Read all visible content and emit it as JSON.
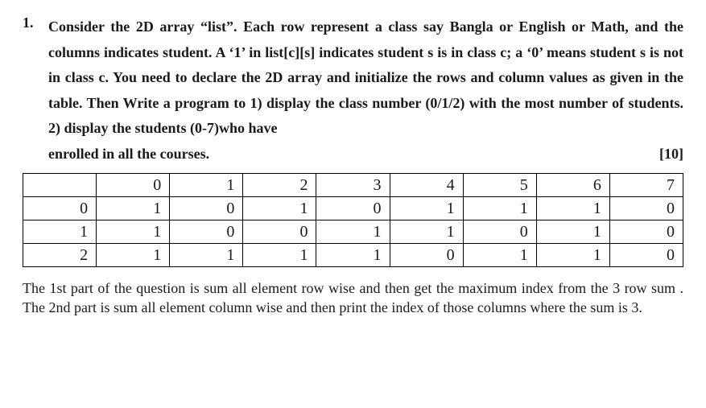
{
  "question": {
    "number": "1.",
    "prompt_line1": "Consider the 2D array “list”. Each row represent a class say Bangla or  English or Math,",
    "prompt_line2": "and the columns indicates student. A ‘1’ in list[c][s] indicates student s is in class c; a ‘0’",
    "prompt_line3": "means student s is not in class c.  You need to declare the 2D array and initialize the rows",
    "prompt_line4": "and column values as given in the table. Then Write a program to 1) display the class",
    "prompt_line5": "number (0/1/2) with the most number of students. 2) display the students  (0-7)who have",
    "prompt_line6": "enrolled in all the courses.",
    "marks": "[10]"
  },
  "table": {
    "col_headers": [
      "0",
      "1",
      "2",
      "3",
      "4",
      "5",
      "6",
      "7"
    ],
    "rows": [
      {
        "label": "0",
        "cells": [
          "1",
          "0",
          "1",
          "0",
          "1",
          "1",
          "1",
          "0"
        ]
      },
      {
        "label": "1",
        "cells": [
          "1",
          "0",
          "0",
          "1",
          "1",
          "0",
          "1",
          "0"
        ]
      },
      {
        "label": "2",
        "cells": [
          "1",
          "1",
          "1",
          "1",
          "0",
          "1",
          "1",
          "0"
        ]
      }
    ]
  },
  "explanation": "The 1st part of the question is sum all element row wise and then get the maximum index  from the 3 row sum . The 2nd part is sum all element column wise and then print the index of those columns where the sum is 3.",
  "chart_data": {
    "type": "table",
    "columns": [
      "0",
      "1",
      "2",
      "3",
      "4",
      "5",
      "6",
      "7"
    ],
    "rows": [
      "0",
      "1",
      "2"
    ],
    "values": [
      [
        1,
        0,
        1,
        0,
        1,
        1,
        1,
        0
      ],
      [
        1,
        0,
        0,
        1,
        1,
        0,
        1,
        0
      ],
      [
        1,
        1,
        1,
        1,
        0,
        1,
        1,
        0
      ]
    ]
  }
}
